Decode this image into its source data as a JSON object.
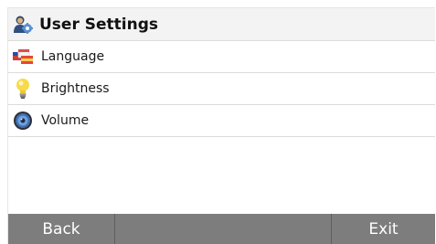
{
  "header": {
    "title": "User Settings",
    "icon": "user-settings-icon"
  },
  "items": [
    {
      "label": "Language",
      "icon": "flags-icon"
    },
    {
      "label": "Brightness",
      "icon": "lightbulb-icon"
    },
    {
      "label": "Volume",
      "icon": "speaker-icon"
    }
  ],
  "footer": {
    "back_label": "Back",
    "exit_label": "Exit"
  },
  "colors": {
    "footer_bg": "#7d7d7d",
    "header_bg": "#f3f3f3"
  }
}
